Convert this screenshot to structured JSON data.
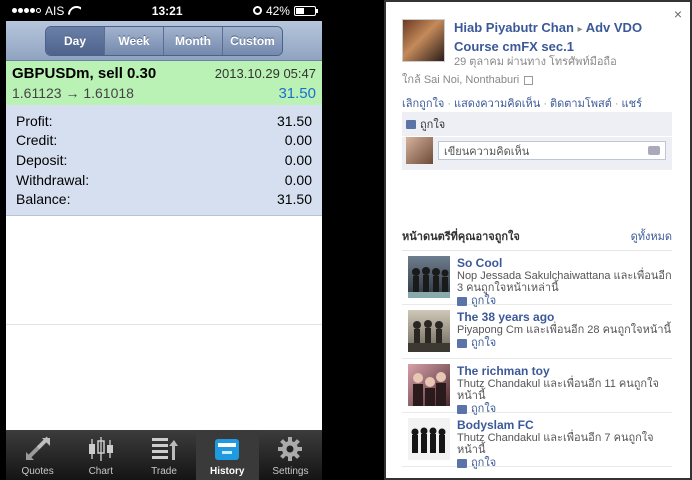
{
  "status_bar": {
    "carrier": "AIS",
    "time": "13:21",
    "battery": "42%",
    "battery_level": 0.42
  },
  "period_tabs": [
    {
      "label": "Day",
      "active": true
    },
    {
      "label": "Week",
      "active": false
    },
    {
      "label": "Month",
      "active": false
    },
    {
      "label": "Custom",
      "active": false
    }
  ],
  "deal": {
    "symbol": "GBPUSDm, sell 0.30",
    "datetime": "2013.10.29 05:47",
    "prices": "1.61123 → 1.61018",
    "profit": "31.50"
  },
  "summary": [
    {
      "label": "Profit:",
      "value": "31.50"
    },
    {
      "label": "Credit:",
      "value": "0.00"
    },
    {
      "label": "Deposit:",
      "value": "0.00"
    },
    {
      "label": "Withdrawal:",
      "value": "0.00"
    },
    {
      "label": "Balance:",
      "value": "31.50"
    }
  ],
  "tab_bar": [
    {
      "label": "Quotes",
      "icon": "quotes-icon",
      "active": false
    },
    {
      "label": "Chart",
      "icon": "chart-icon",
      "active": false
    },
    {
      "label": "Trade",
      "icon": "trade-icon",
      "active": false
    },
    {
      "label": "History",
      "icon": "history-icon",
      "active": true
    },
    {
      "label": "Settings",
      "icon": "gear-icon",
      "active": false
    }
  ],
  "fb": {
    "close": "×",
    "post_author": "Hiab Piyabutr Chan",
    "arrow": "▸",
    "post_target": "Adv VDO Course cmFX sec.1",
    "post_meta": "29 ตุลาคม ผ่านทาง โทรศัพท์มือถือ",
    "location": "ใกล้ Sai Noi, Nonthaburi",
    "actions": [
      "เลิกถูกใจ",
      "แสดงความคิดเห็น",
      "ติดตามโพสต์",
      "แชร์"
    ],
    "action_sep": "·",
    "like_label": "ถูกใจ",
    "comment_placeholder": "เขียนความคิดเห็น",
    "pages_header": "หน้าดนตรีที่คุณอาจถูกใจ",
    "see_all": "ดูทั้งหมด",
    "pages": [
      {
        "name": "So Cool",
        "friends": "Nop Jessada Sakulchaiwattana และเพื่อนอีก 3 คนถูกใจหน้าเหล่านี้",
        "like": "ถูกใจ"
      },
      {
        "name": "The 38 years ago",
        "friends": "Piyapong Cm และเพื่อนอีก 28 คนถูกใจหน้านี้",
        "like": "ถูกใจ"
      },
      {
        "name": "The richman toy",
        "friends": "Thutz Chandakul และเพื่อนอีก 11 คนถูกใจหน้านี้",
        "like": "ถูกใจ"
      },
      {
        "name": "Bodyslam FC",
        "friends": "Thutz Chandakul และเพื่อนอีก 7 คนถูกใจหน้านี้",
        "like": "ถูกใจ"
      }
    ]
  }
}
